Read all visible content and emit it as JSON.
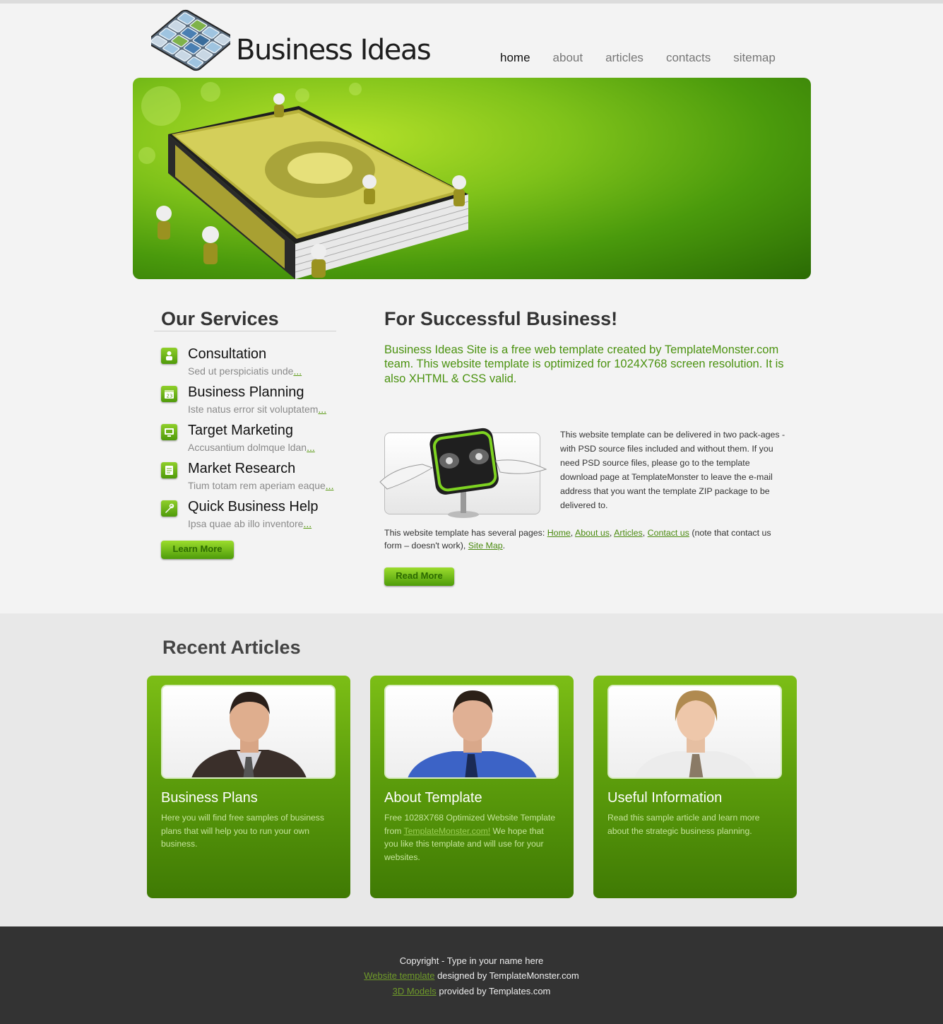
{
  "header": {
    "logo_text": "Business Ideas",
    "nav": [
      "home",
      "about",
      "articles",
      "contacts",
      "sitemap"
    ],
    "active_nav": "home"
  },
  "services": {
    "title": "Our Services",
    "items": [
      {
        "name": "Consultation",
        "desc": "Sed ut perspiciatis unde",
        "icon": "consultation-icon"
      },
      {
        "name": "Business Planning",
        "desc": "Iste natus error sit voluptatem",
        "icon": "calendar-icon"
      },
      {
        "name": "Target Marketing",
        "desc": "Accusantium dolmque ldan",
        "icon": "monitor-icon"
      },
      {
        "name": "Market Research",
        "desc": "Tium totam rem aperiam eaque",
        "icon": "document-icon"
      },
      {
        "name": "Quick Business Help",
        "desc": "Ipsa quae ab illo inventore",
        "icon": "tool-icon"
      }
    ],
    "more_link": "...",
    "button": "Learn More"
  },
  "main": {
    "title": "For Successful Business!",
    "intro_lines": [
      "Business Ideas Site is a free web template created by TemplateMonster.com",
      "team. This website template is optimized for 1024X768 screen resolution. It is",
      "also XHTML & CSS valid."
    ],
    "description": "This website template can be delivered in two pack-ages - with PSD source files included and without them. If you need PSD source files, please go to the template download page at TemplateMonster to leave the e-mail address that you want the template ZIP package to be delivered to.",
    "pages_prefix": "This website template has several pages:",
    "pages_links": [
      "Home",
      "About us",
      "Articles",
      "Contact us",
      "Site Map"
    ],
    "pages_note": "(note that contact us form – doesn't work),",
    "button": "Read More"
  },
  "recent": {
    "title": "Recent Articles",
    "cards": [
      {
        "title": "Business Plans",
        "text": "Here you will find free samples of business plans that will help you to run your own business."
      },
      {
        "title": "About Template",
        "text_before": "Free 1028X768 Optimized Website Template from",
        "link": "TemplateMonster.com!",
        "text_after": "We hope that you like this template and will use for your websites."
      },
      {
        "title": "Useful Information",
        "text": "Read this sample article and learn more about the strategic business planning."
      }
    ]
  },
  "footer": {
    "copyright": "Copyright - Type in your name here",
    "line2_link": "Website template",
    "line2_text": "designed by TemplateMonster.com",
    "line3_link": "3D Models",
    "line3_text": "provided by Templates.com"
  },
  "colors": {
    "accent": "#5a9f10",
    "footer_bg": "#333333",
    "text_green": "#4b9210"
  }
}
